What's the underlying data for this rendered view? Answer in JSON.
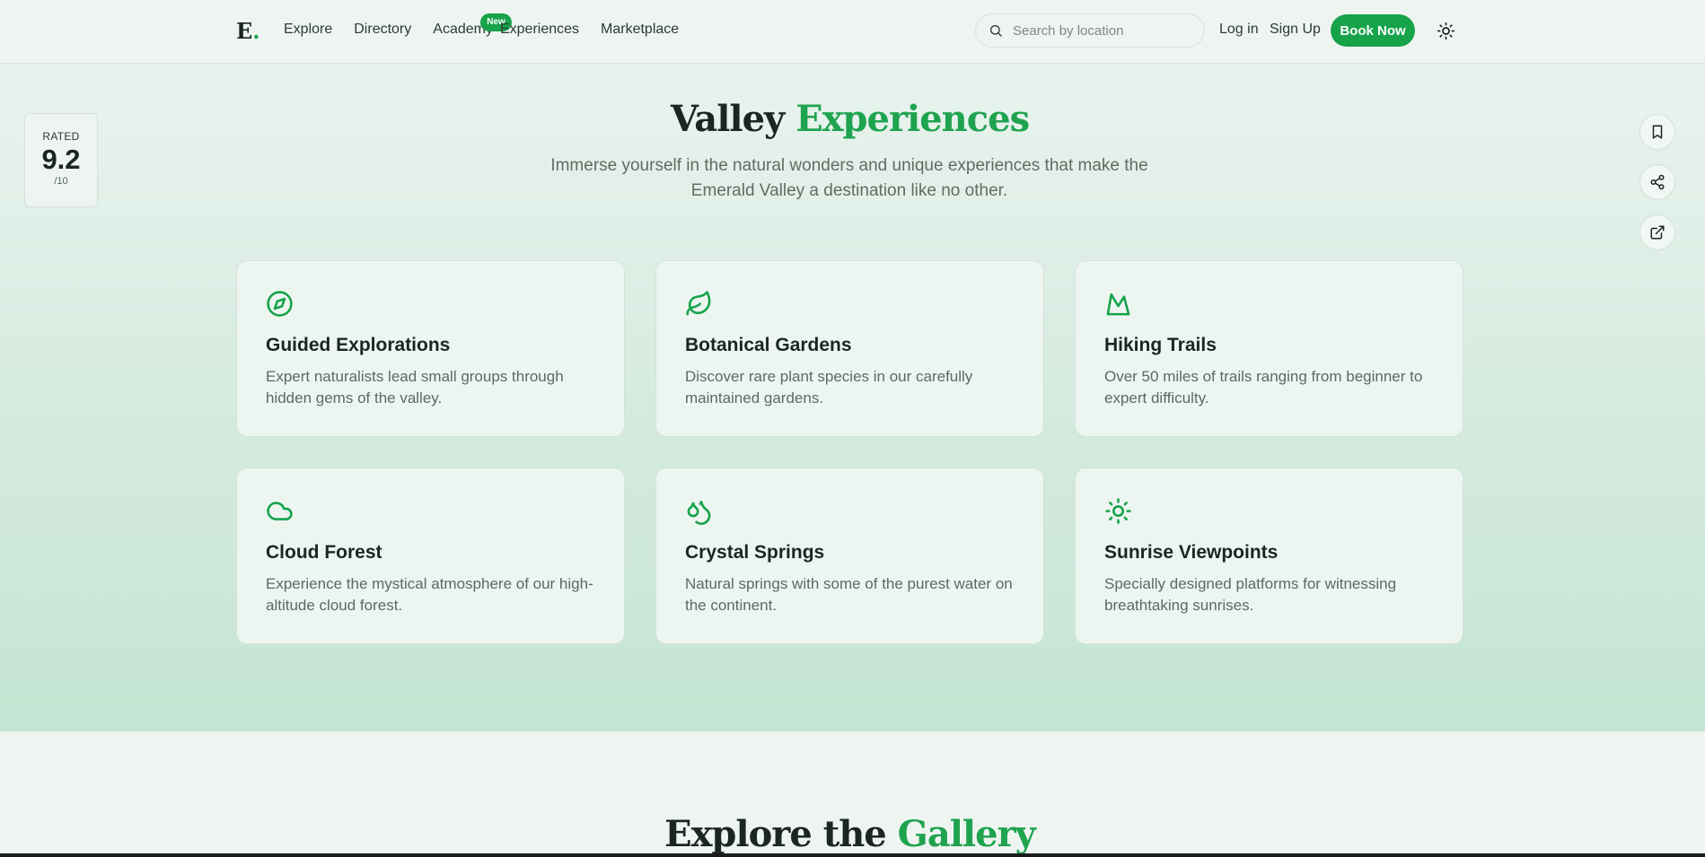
{
  "brand": {
    "logo": "E",
    "logo_dot": "."
  },
  "nav": {
    "links": [
      "Explore",
      "Directory",
      "Academy",
      "Experiences",
      "Marketplace"
    ],
    "academy_badge": "New"
  },
  "search": {
    "placeholder": "Search by location",
    "icon": "search-icon"
  },
  "auth": {
    "login": "Log in",
    "signup": "Sign Up"
  },
  "cta": {
    "book_now": "Book Now"
  },
  "theme_toggle_icon": "sun-icon",
  "rating": {
    "label": "RATED",
    "value": "9.2",
    "scale": "/10"
  },
  "side_actions": [
    "bookmark-icon",
    "share-icon",
    "external-link-icon"
  ],
  "experiences": {
    "title_main": "Valley ",
    "title_accent": "Experiences",
    "subtitle": "Immerse yourself in the natural wonders and unique experiences that make the Emerald Valley a destination like no other.",
    "cards": [
      {
        "icon": "compass-icon",
        "title": "Guided Explorations",
        "desc": "Expert naturalists lead small groups through hidden gems of the valley."
      },
      {
        "icon": "leaf-icon",
        "title": "Botanical Gardens",
        "desc": "Discover rare plant species in our carefully maintained gardens."
      },
      {
        "icon": "mountain-icon",
        "title": "Hiking Trails",
        "desc": "Over 50 miles of trails ranging from beginner to expert difficulty."
      },
      {
        "icon": "cloud-icon",
        "title": "Cloud Forest",
        "desc": "Experience the mystical atmosphere of our high-altitude cloud forest."
      },
      {
        "icon": "droplets-icon",
        "title": "Crystal Springs",
        "desc": "Natural springs with some of the purest water on the continent."
      },
      {
        "icon": "sun-icon",
        "title": "Sunrise Viewpoints",
        "desc": "Specially designed platforms for witnessing breathtaking sunrises."
      }
    ]
  },
  "gallery": {
    "title_main": "Explore the ",
    "title_accent": "Gallery"
  },
  "colors": {
    "accent": "#16a34a",
    "text": "#1c2620",
    "muted": "#5b6a62",
    "background": "#eef5f1"
  }
}
